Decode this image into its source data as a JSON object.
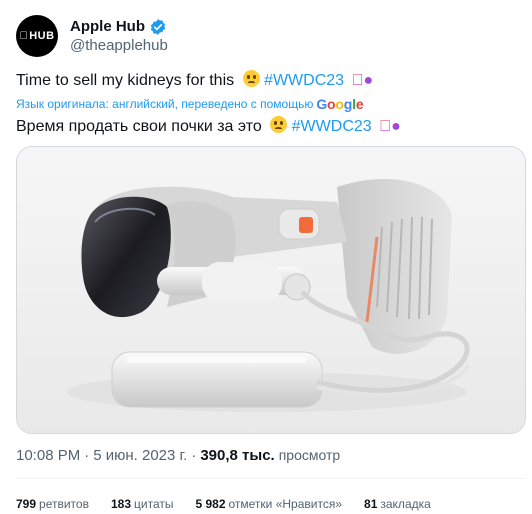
{
  "author": {
    "avatar_text": "HUB",
    "name": "Apple Hub",
    "handle": "@theapplehub"
  },
  "tweet": {
    "text_original": "Time to sell my kidneys for this",
    "hashtag": "#WWDC23",
    "translation_note": "Язык оригинала: английский, переведено с помощью",
    "translator": "Google",
    "text_translated": "Время продать свои почки за это"
  },
  "meta": {
    "time": "10:08 PM",
    "date": "5 июн. 2023 г.",
    "views": "390,8 тыс.",
    "views_label": "просмотр"
  },
  "stats": [
    {
      "value": "799",
      "label": "ретвитов"
    },
    {
      "value": "183",
      "label": "цитаты"
    },
    {
      "value": "5 982",
      "label": "отметки «Нравится»"
    },
    {
      "value": "81",
      "label": "закладка"
    }
  ],
  "colors": {
    "link": "#1d9bf0",
    "muted": "#536471",
    "accent_orange": "#f26b3a"
  }
}
